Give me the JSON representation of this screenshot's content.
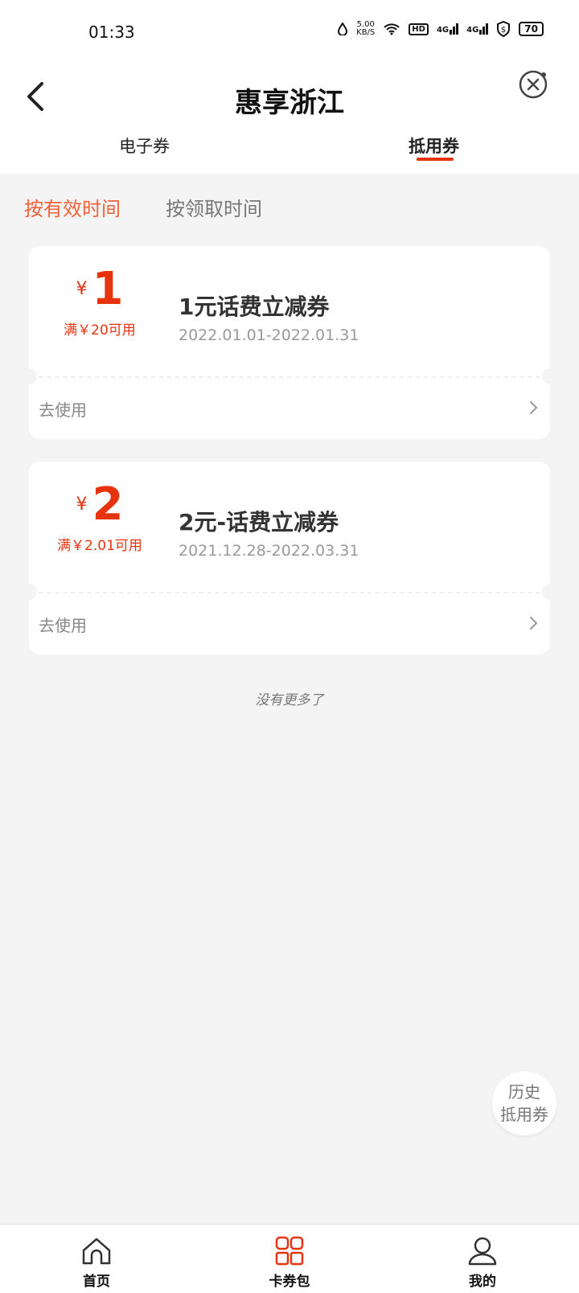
{
  "status_bar": {
    "time": "01:33",
    "net_speed_top": "5.00",
    "net_speed_bottom": "KB/S",
    "hd": "HD",
    "sig1": "4G",
    "sig2": "4G",
    "battery": "70"
  },
  "header": {
    "title": "惠享浙江"
  },
  "tabs": [
    {
      "label": "电子券",
      "active": false
    },
    {
      "label": "抵用券",
      "active": true
    }
  ],
  "sort": {
    "by_valid_time": "按有效时间",
    "by_claim_time": "按领取时间"
  },
  "coupons": [
    {
      "currency": "¥",
      "amount": "1",
      "condition": "满￥20可用",
      "title": "1元话费立减券",
      "date_range": "2022.01.01-2022.01.31",
      "action": "去使用"
    },
    {
      "currency": "¥",
      "amount": "2",
      "condition": "满￥2.01可用",
      "title": "2元-话费立减券",
      "date_range": "2021.12.28-2022.03.31",
      "action": "去使用"
    }
  ],
  "list_end": "没有更多了",
  "history_button": {
    "line1": "历史",
    "line2": "抵用券"
  },
  "bottom_nav": [
    {
      "label": "首页",
      "icon": "home-icon",
      "active": false
    },
    {
      "label": "卡券包",
      "icon": "grid-icon",
      "active": true
    },
    {
      "label": "我的",
      "icon": "person-icon",
      "active": false
    }
  ],
  "colors": {
    "accent": "#e8330f",
    "sort_active": "#f0613a",
    "background": "#f4f4f4"
  }
}
